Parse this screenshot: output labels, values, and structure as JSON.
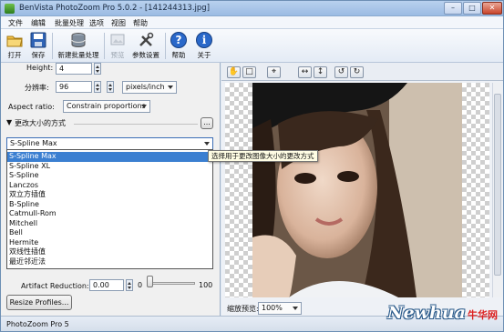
{
  "window": {
    "title": "BenVista PhotoZoom Pro 5.0.2 - [141244313.jpg]",
    "min_icon": "minimize-icon",
    "max_icon": "maximize-icon",
    "close_icon": "close-icon"
  },
  "menu": [
    "文件",
    "编辑",
    "批量处理",
    "选项",
    "视图",
    "帮助"
  ],
  "toolbar": {
    "open": "打开",
    "save": "保存",
    "batch": "新建批量处理",
    "preview": "预览",
    "settings": "参数设置",
    "help": "帮助",
    "about": "关于"
  },
  "size": {
    "height_label": "Height:",
    "height_value": "4",
    "resolution_label": "分辨率:",
    "resolution_value": "96",
    "resolution_unit": "pixels/inch",
    "aspect_label": "Aspect ratio:",
    "aspect_value": "Constrain proportions"
  },
  "resize_method": {
    "section_title": "更改大小的方式",
    "more_button": "...",
    "selected": "S-Spline Max",
    "options": [
      "S-Spline Max",
      "S-Spline XL",
      "S-Spline",
      "Lanczos",
      "双立方插值",
      "B-Spline",
      "Catmull-Rom",
      "Mitchell",
      "Bell",
      "Hermite",
      "双线性插值",
      "最近邻近法"
    ],
    "tooltip": "选择用于更改图像大小的更改方式"
  },
  "artifact": {
    "label": "Artifact Reduction:",
    "value": "0.00",
    "min": "0",
    "max": "100",
    "level_fraction": 0
  },
  "resize_profiles_button": "Resize Profiles...",
  "preview": {
    "zoom_label": "缩放预览:",
    "zoom_value": "100%"
  },
  "status": "PhotoZoom Pro 5",
  "watermark": {
    "latin": "Newhua",
    "cn": "牛华网"
  },
  "colors": {
    "selection": "#3b7fd1",
    "accent": "#2a5a8a"
  }
}
